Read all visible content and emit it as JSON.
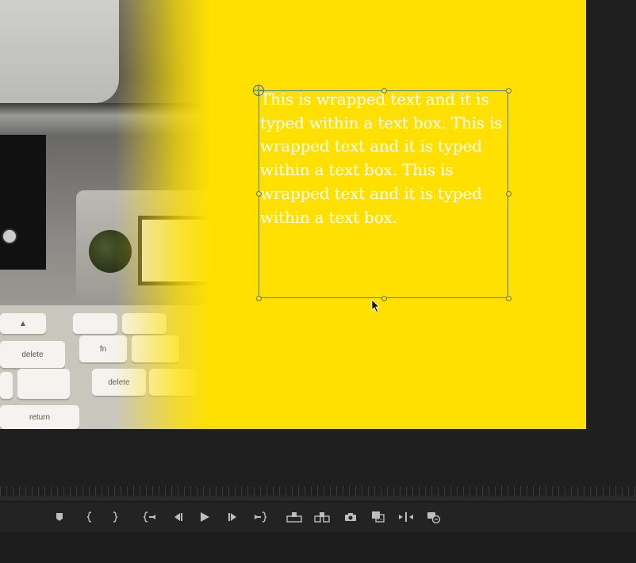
{
  "program_monitor": {
    "background_color": "#ffe000",
    "text_box": {
      "text": "This is wrapped text and it is typed within a text box. This is wrapped text and it is typed within a text box. This is wrapped text and it is typed within a text box.",
      "text_color": "#ffffff"
    },
    "photo_keys": {
      "delete1": "delete",
      "fn": "fn",
      "delete2": "delete",
      "return": "return"
    }
  },
  "transport_controls": [
    {
      "name": "add-marker",
      "icon": "marker-icon"
    },
    {
      "name": "mark-in",
      "icon": "mark-in-icon"
    },
    {
      "name": "mark-out",
      "icon": "mark-out-icon"
    },
    {
      "name": "go-to-in",
      "icon": "go-to-in-icon"
    },
    {
      "name": "step-back",
      "icon": "step-back-icon"
    },
    {
      "name": "play",
      "icon": "play-icon"
    },
    {
      "name": "step-forward",
      "icon": "step-forward-icon"
    },
    {
      "name": "go-to-out",
      "icon": "go-to-out-icon"
    },
    {
      "name": "lift",
      "icon": "lift-icon"
    },
    {
      "name": "extract",
      "icon": "extract-icon"
    },
    {
      "name": "export-frame",
      "icon": "camera-icon"
    },
    {
      "name": "comparison-view",
      "icon": "comparison-view-icon"
    },
    {
      "name": "trim",
      "icon": "trim-icon"
    },
    {
      "name": "multi-camera",
      "icon": "multicam-icon"
    }
  ]
}
